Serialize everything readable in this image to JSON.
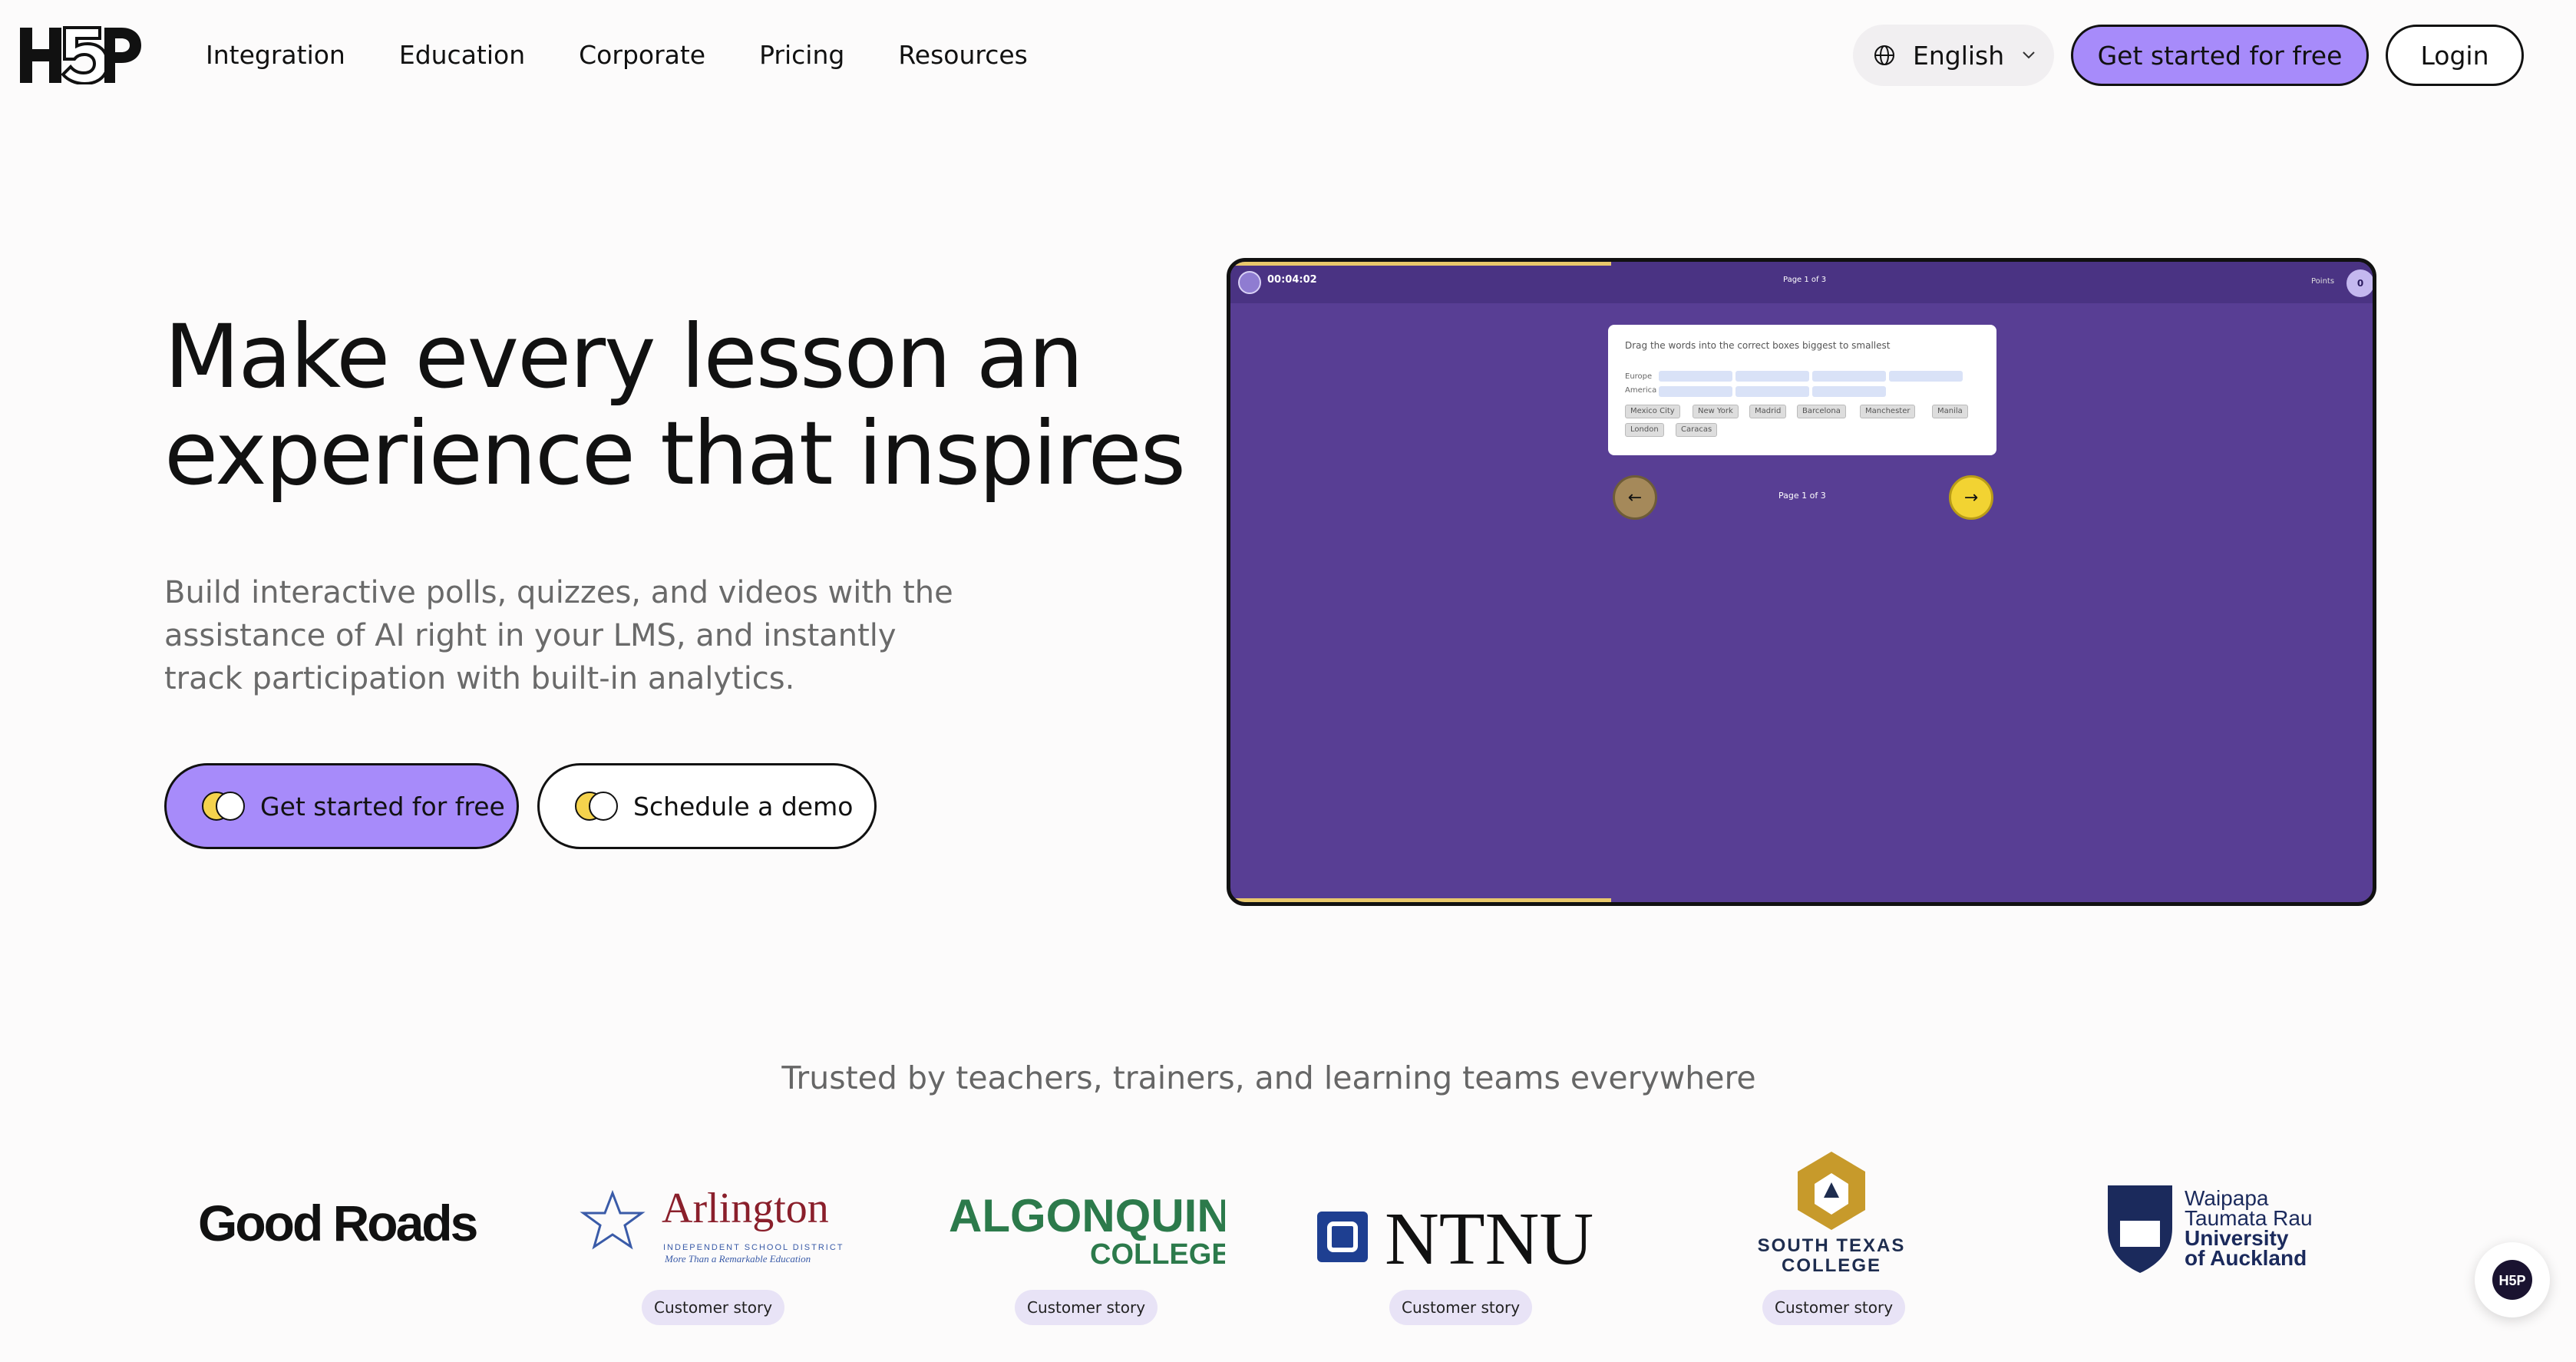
{
  "nav": {
    "logo_text": "H5P",
    "links": [
      "Integration",
      "Education",
      "Corporate",
      "Pricing",
      "Resources"
    ],
    "language": "English",
    "cta": "Get started for free",
    "login": "Login"
  },
  "hero": {
    "title": "Make every lesson an experience that inspires",
    "subtitle": "Build interactive polls, quizzes, and videos with the assistance of AI right in your LMS, and instantly track participation with built-in analytics.",
    "cta_primary": "Get started for free",
    "cta_secondary": "Schedule a demo"
  },
  "demo": {
    "timer": "00:04:02",
    "page_top": "Page 1 of 3",
    "points_label": "Points",
    "points_value": "0",
    "question": "Drag the words into the correct boxes biggest to smallest",
    "rows": [
      "Europe",
      "America"
    ],
    "chips": [
      "Mexico City",
      "New York",
      "Madrid",
      "Barcelona",
      "Manchester",
      "Manila",
      "London",
      "Caracas"
    ],
    "page_mid": "Page 1 of 3"
  },
  "trusted": {
    "heading": "Trusted by teachers, trainers, and learning teams everywhere",
    "logos": {
      "good_roads": "Good Roads",
      "arlington_name": "Arlington",
      "arlington_sub": "INDEPENDENT SCHOOL DISTRICT",
      "arlington_tag": "More Than a Remarkable Education",
      "algonquin_a": "ALGONQUIN",
      "algonquin_b": "COLLEGE",
      "ntnu": "NTNU",
      "stc_a": "SOUTH TEXAS",
      "stc_b": "COLLEGE",
      "auckland_a": "Waipapa",
      "auckland_b": "Taumata Rau",
      "auckland_c": "University",
      "auckland_d": "of Auckland"
    },
    "story_label": "Customer story"
  },
  "colors": {
    "accent": "#a78bfa",
    "demo_bg": "#583e94",
    "demo_bar": "#4a3383",
    "yellow": "#f2d332"
  }
}
